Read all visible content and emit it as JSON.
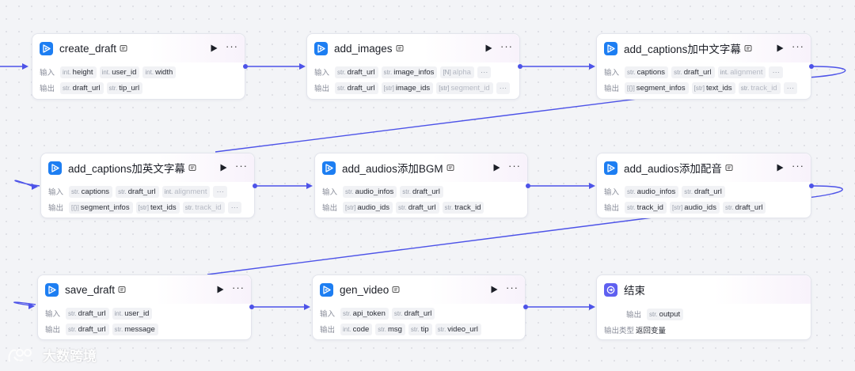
{
  "labels": {
    "input": "输入",
    "output": "输出",
    "output_type": "输出类型"
  },
  "nodes": {
    "create_draft": {
      "title": "create_draft",
      "inputs": [
        {
          "type": "int.",
          "name": "height"
        },
        {
          "type": "int.",
          "name": "user_id"
        },
        {
          "type": "int.",
          "name": "width"
        }
      ],
      "outputs": [
        {
          "type": "str.",
          "name": "draft_url"
        },
        {
          "type": "str.",
          "name": "tip_url"
        }
      ]
    },
    "add_images": {
      "title": "add_images",
      "inputs": [
        {
          "type": "str.",
          "name": "draft_url"
        },
        {
          "type": "str.",
          "name": "image_infos"
        },
        {
          "type": "[N]",
          "name": "alpha"
        }
      ],
      "outputs": [
        {
          "type": "str.",
          "name": "draft_url"
        },
        {
          "type": "[str]",
          "name": "image_ids"
        },
        {
          "type": "[str]",
          "name": "segment_id"
        }
      ],
      "more": "···"
    },
    "add_captions_cn": {
      "title": "add_captions加中文字幕",
      "inputs": [
        {
          "type": "str.",
          "name": "captions"
        },
        {
          "type": "str.",
          "name": "draft_url"
        },
        {
          "type": "int.",
          "name": "alignment"
        }
      ],
      "outputs": [
        {
          "type": "[{}]",
          "name": "segment_infos"
        },
        {
          "type": "[str]",
          "name": "text_ids"
        },
        {
          "type": "str.",
          "name": "track_id"
        }
      ],
      "more": "···"
    },
    "add_captions_en": {
      "title": "add_captions加英文字幕",
      "inputs": [
        {
          "type": "str.",
          "name": "captions"
        },
        {
          "type": "str.",
          "name": "draft_url"
        },
        {
          "type": "int.",
          "name": "alignment"
        }
      ],
      "outputs": [
        {
          "type": "[{}]",
          "name": "segment_infos"
        },
        {
          "type": "[str]",
          "name": "text_ids"
        },
        {
          "type": "str.",
          "name": "track_id"
        }
      ],
      "more": "···"
    },
    "add_audios_bgm": {
      "title": "add_audios添加BGM",
      "inputs": [
        {
          "type": "str.",
          "name": "audio_infos"
        },
        {
          "type": "str.",
          "name": "draft_url"
        }
      ],
      "outputs": [
        {
          "type": "[str]",
          "name": "audio_ids"
        },
        {
          "type": "str.",
          "name": "draft_url"
        },
        {
          "type": "str.",
          "name": "track_id"
        }
      ]
    },
    "add_audios_voice": {
      "title": "add_audios添加配音",
      "inputs": [
        {
          "type": "str.",
          "name": "audio_infos"
        },
        {
          "type": "str.",
          "name": "draft_url"
        }
      ],
      "outputs": [
        {
          "type": "str.",
          "name": "track_id"
        },
        {
          "type": "[str]",
          "name": "audio_ids"
        },
        {
          "type": "str.",
          "name": "draft_url"
        }
      ]
    },
    "save_draft": {
      "title": "save_draft",
      "inputs": [
        {
          "type": "str.",
          "name": "draft_url"
        },
        {
          "type": "int.",
          "name": "user_id"
        }
      ],
      "outputs": [
        {
          "type": "str.",
          "name": "draft_url"
        },
        {
          "type": "str.",
          "name": "message"
        }
      ]
    },
    "gen_video": {
      "title": "gen_video",
      "inputs": [
        {
          "type": "str.",
          "name": "api_token"
        },
        {
          "type": "str.",
          "name": "draft_url"
        }
      ],
      "outputs": [
        {
          "type": "int.",
          "name": "code"
        },
        {
          "type": "str.",
          "name": "msg"
        },
        {
          "type": "str.",
          "name": "tip"
        },
        {
          "type": "str.",
          "name": "video_url"
        }
      ]
    },
    "end": {
      "title": "结束",
      "outputs": [
        {
          "type": "str.",
          "name": "output"
        }
      ],
      "output_type_value": "返回变量"
    }
  },
  "buttons": {
    "more": "···"
  },
  "watermark": {
    "text": "大数跨境"
  },
  "colors": {
    "edge": "#4d53e8",
    "plugin_icon": "#1d7ef2",
    "end_icon": "#5f60f0"
  }
}
